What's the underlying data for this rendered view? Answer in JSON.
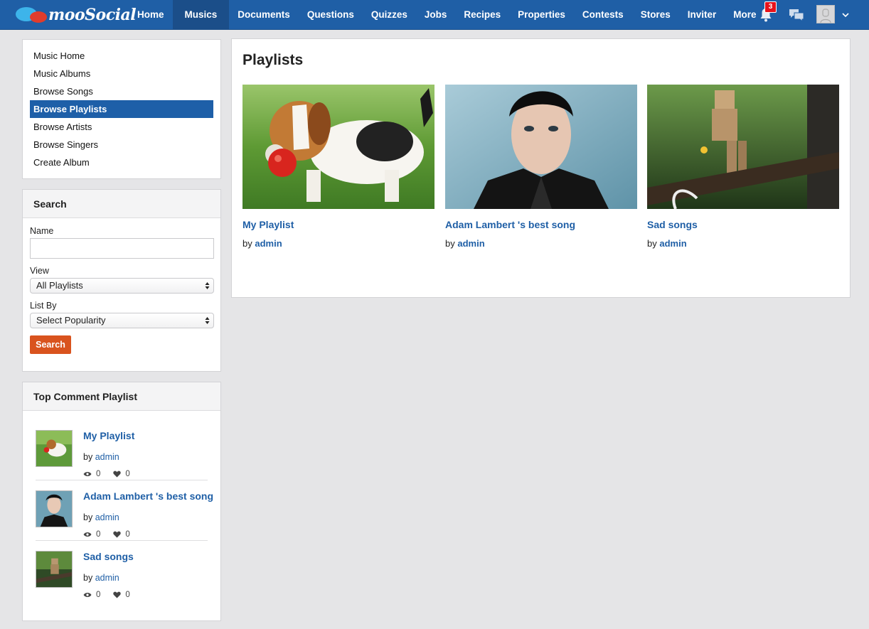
{
  "brand": {
    "name": "mooSocial"
  },
  "nav": {
    "items": [
      "Home",
      "Musics",
      "Documents",
      "Questions",
      "Quizzes",
      "Jobs",
      "Recipes",
      "Properties",
      "Contests",
      "Stores",
      "Inviter",
      "More"
    ],
    "active": "Musics",
    "notification_count": "3"
  },
  "sidebar_menu": {
    "items": [
      "Music Home",
      "Music Albums",
      "Browse Songs",
      "Browse Playlists",
      "Browse Artists",
      "Browse Singers",
      "Create Album"
    ],
    "active": "Browse Playlists"
  },
  "search": {
    "title": "Search",
    "name_label": "Name",
    "name_value": "",
    "view_label": "View",
    "view_value": "All Playlists",
    "listby_label": "List By",
    "listby_value": "Select Popularity",
    "button": "Search"
  },
  "top_comment": {
    "title": "Top Comment Playlist",
    "items": [
      {
        "title": "My Playlist",
        "by": "by",
        "user": "admin",
        "views": "0",
        "likes": "0"
      },
      {
        "title": "Adam Lambert 's best song",
        "by": "by",
        "user": "admin",
        "views": "0",
        "likes": "0"
      },
      {
        "title": "Sad songs",
        "by": "by",
        "user": "admin",
        "views": "0",
        "likes": "0"
      }
    ]
  },
  "main": {
    "title": "Playlists",
    "cards": [
      {
        "title": "My Playlist",
        "by": "by",
        "user": "admin"
      },
      {
        "title": "Adam Lambert 's best song",
        "by": "by",
        "user": "admin"
      },
      {
        "title": "Sad songs",
        "by": "by",
        "user": "admin"
      }
    ]
  },
  "colors": {
    "primary": "#1f5fa6",
    "accent": "#d9531e",
    "badge": "#e7121b"
  }
}
